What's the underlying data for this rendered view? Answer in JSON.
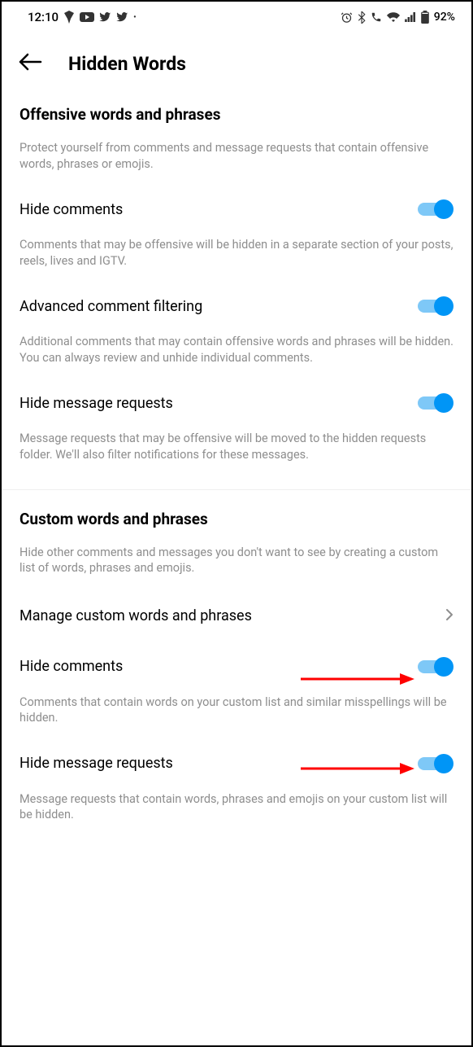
{
  "status_bar": {
    "time": "12:10",
    "battery_text": "92%"
  },
  "header": {
    "title": "Hidden Words"
  },
  "section1": {
    "title": "Offensive words and phrases",
    "desc": "Protect yourself from comments and message requests that contain offensive words, phrases or emojis.",
    "settings": [
      {
        "label": "Hide comments",
        "desc": "Comments that may be offensive will be hidden in a separate section of your posts, reels, lives and IGTV."
      },
      {
        "label": "Advanced comment filtering",
        "desc": "Additional comments that may contain offensive words and phrases will be hidden. You can always review and unhide individual comments."
      },
      {
        "label": "Hide message requests",
        "desc": "Message requests that may be offensive will be moved to the hidden requests folder. We'll also filter notifications for these messages."
      }
    ]
  },
  "section2": {
    "title": "Custom words and phrases",
    "desc": "Hide other comments and messages you don't want to see by creating a custom list of words, phrases and emojis.",
    "manage_label": "Manage custom words and phrases",
    "settings": [
      {
        "label": "Hide comments",
        "desc": "Comments that contain words on your custom list and similar misspellings will be hidden."
      },
      {
        "label": "Hide message requests",
        "desc": "Message requests that contain words, phrases and emojis on your custom list will be hidden."
      }
    ]
  }
}
